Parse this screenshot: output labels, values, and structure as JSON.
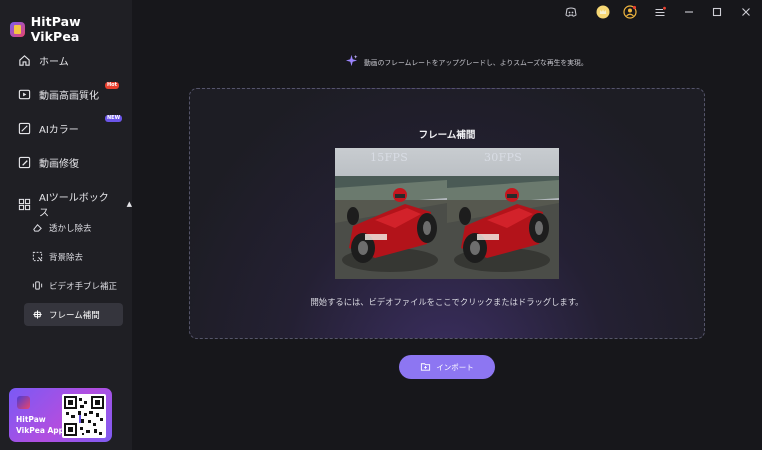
{
  "app": {
    "name": "HitPaw VikPea"
  },
  "sidebar": {
    "items": [
      {
        "label": "ホーム",
        "icon": "home-icon"
      },
      {
        "label": "動画高画質化",
        "icon": "video-enhance-icon",
        "badge": "Hot"
      },
      {
        "label": "AIカラー",
        "icon": "ai-color-icon",
        "badge": "NEW"
      },
      {
        "label": "動画修復",
        "icon": "video-repair-icon"
      },
      {
        "label": "AIツールボックス",
        "icon": "toolbox-icon",
        "expanded": true
      }
    ],
    "subitems": [
      {
        "label": "透かし除去",
        "icon": "eraser-icon"
      },
      {
        "label": "背景除去",
        "icon": "background-remove-icon"
      },
      {
        "label": "ビデオ手ブレ補正",
        "icon": "stabilize-icon"
      },
      {
        "label": "フレーム補間",
        "icon": "frame-interpolation-icon",
        "active": true
      }
    ],
    "promo": {
      "line1": "HitPaw",
      "line2": "VikPea App"
    }
  },
  "topbar": {
    "icons": [
      "discord-icon",
      "crown-icon",
      "account-icon",
      "menu-icon",
      "minimize-icon",
      "maximize-icon",
      "close-icon"
    ]
  },
  "main": {
    "hint": "動画のフレームレートをアップグレードし、よりスムーズな再生を実現。",
    "dropzone": {
      "title": "フレーム補間",
      "preview": {
        "left_label": "15FPS",
        "right_label": "30FPS"
      },
      "description": "開始するには、ビデオファイルをここでクリックまたはドラッグします。"
    },
    "import_button": "インポート"
  },
  "colors": {
    "accent": "#8d76f2",
    "sidebar_bg": "#1f1f24",
    "main_bg": "#17171b",
    "hot_badge": "#e8402f",
    "new_badge": "#6b55e8"
  }
}
